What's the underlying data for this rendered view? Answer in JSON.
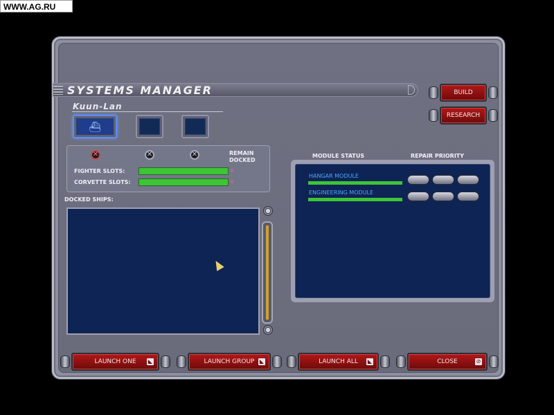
{
  "watermark": "WWW.AG.RU",
  "title": "SYSTEMS MANAGER",
  "ship": {
    "name": "Kuun-Lan"
  },
  "buttons": {
    "build": "BUILD",
    "research": "RESEARCH"
  },
  "slots": {
    "remain_docked_label": "REMAIN\nDOCKED",
    "fighter_label": "FIGHTER SLOTS:",
    "corvette_label": "CORVETTE SLOTS:",
    "fighter_count": "0",
    "corvette_count": "0"
  },
  "docked": {
    "label": "DOCKED SHIPS:"
  },
  "modules": {
    "status_label": "MODULE STATUS",
    "priority_label": "REPAIR PRIORITY",
    "items": [
      {
        "name": "HANGAR MODULE",
        "health": 1.0
      },
      {
        "name": "ENGINEERING MODULE",
        "health": 1.0
      }
    ]
  },
  "launch": {
    "one": "LAUNCH ONE",
    "group": "LAUNCH GROUP",
    "all": "LAUNCH ALL",
    "close": "CLOSE"
  },
  "colors": {
    "panel": "#0e2454",
    "accent_red": "#b01818",
    "bar_green": "#3ec437"
  }
}
